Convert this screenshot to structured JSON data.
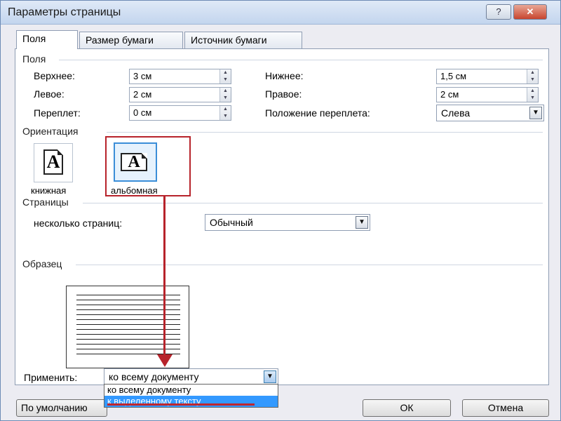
{
  "window": {
    "title": "Параметры страницы",
    "help_glyph": "?",
    "close_glyph": "✕"
  },
  "tabs": [
    {
      "label": "Поля",
      "active": true
    },
    {
      "label": "Размер бумаги",
      "active": false
    },
    {
      "label": "Источник бумаги",
      "active": false
    }
  ],
  "margins": {
    "group_label": "Поля",
    "top": {
      "label": "Верхнее:",
      "value": "3 см"
    },
    "bottom": {
      "label": "Нижнее:",
      "value": "1,5 см"
    },
    "left": {
      "label": "Левое:",
      "value": "2 см"
    },
    "right": {
      "label": "Правое:",
      "value": "2 см"
    },
    "gutter": {
      "label": "Переплет:",
      "value": "0 см"
    },
    "gutter_position": {
      "label": "Положение переплета:",
      "value": "Слева"
    }
  },
  "orientation": {
    "group_label": "Ориентация",
    "portrait_label": "книжная",
    "landscape_label": "альбомная",
    "selected": "landscape",
    "glyph": "A"
  },
  "pages": {
    "group_label": "Страницы",
    "multiple_label": "несколько страниц:",
    "multiple_value": "Обычный"
  },
  "preview": {
    "group_label": "Образец"
  },
  "apply": {
    "label": "Применить:",
    "value": "ко всему документу",
    "options": [
      "ко всему документу",
      "к выделенному тексту"
    ],
    "highlighted_option": "к выделенному тексту"
  },
  "buttons": {
    "default": "По умолчанию",
    "ok": "ОК",
    "cancel": "Отмена"
  },
  "colors": {
    "annotation": "#b7232b",
    "selection": "#3399ff",
    "accent": "#3b8ed8"
  }
}
